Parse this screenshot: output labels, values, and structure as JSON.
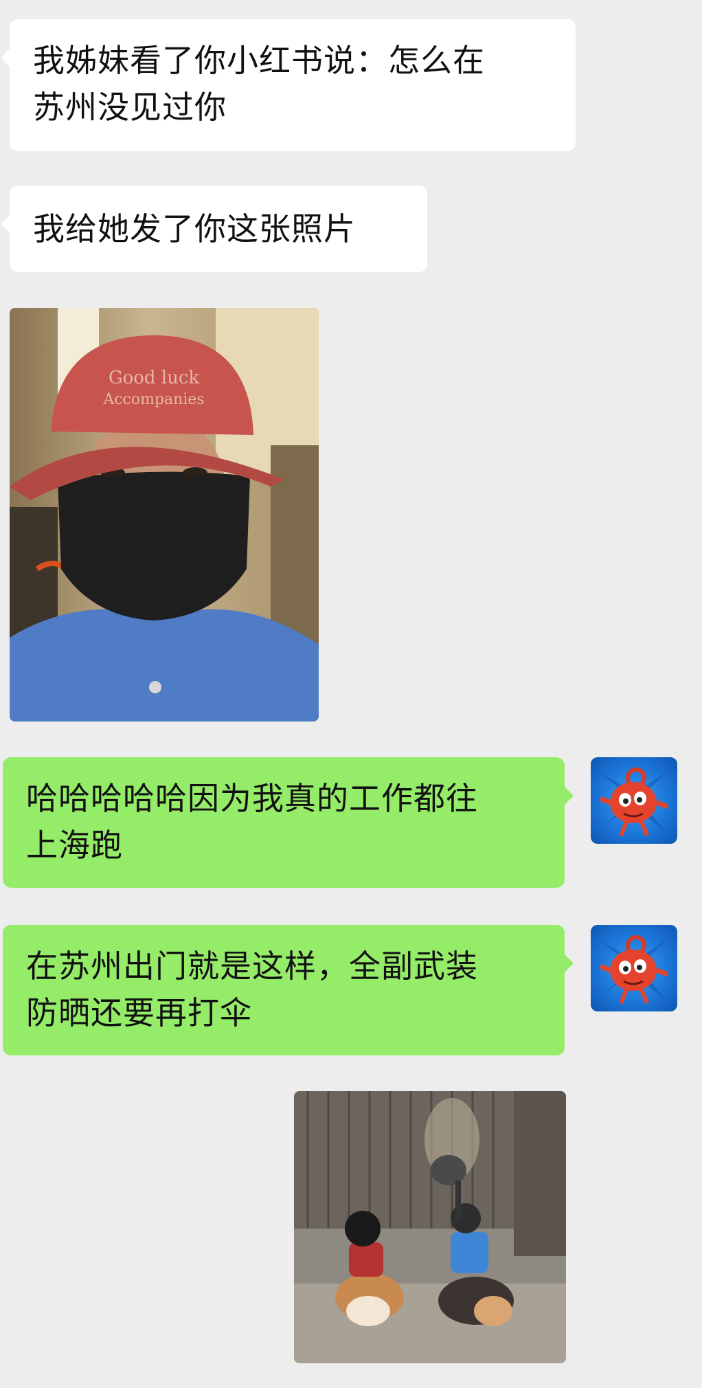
{
  "messages": [
    {
      "side": "left",
      "type": "text",
      "lines": [
        "我姊妹看了你小红书说：怎么在",
        "苏州没见过你"
      ]
    },
    {
      "side": "left",
      "type": "text",
      "lines": [
        "我给她发了你这张照片"
      ]
    },
    {
      "side": "left",
      "type": "image",
      "image": "selfie-photo"
    },
    {
      "side": "right",
      "type": "text",
      "lines": [
        "哈哈哈哈哈因为我真的工作都往",
        "上海跑"
      ]
    },
    {
      "side": "right",
      "type": "text",
      "lines": [
        "在苏州出门就是这样，全副武装",
        "防晒还要再打伞"
      ]
    },
    {
      "side": "right",
      "type": "image",
      "image": "corgi-riders-gif"
    }
  ],
  "avatar": {
    "icon": "cartoon-teapot-avatar-icon"
  },
  "colors": {
    "background": "#ededed",
    "incoming": "#ffffff",
    "outgoing": "#95ec69"
  }
}
